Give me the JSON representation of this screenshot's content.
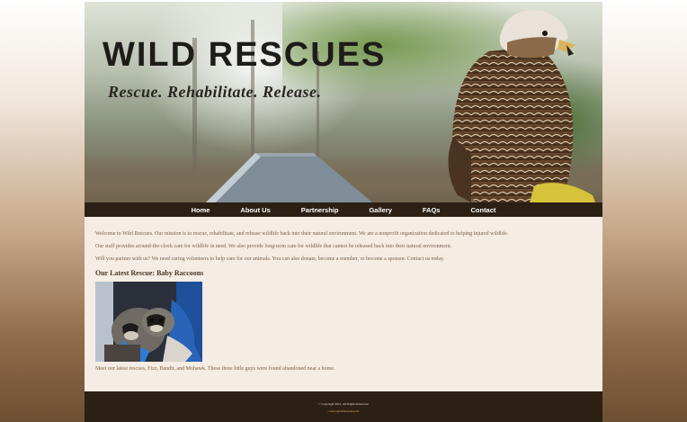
{
  "header": {
    "title": "WILD RESCUES",
    "tagline": "Rescue. Rehabilitate. Release."
  },
  "nav": {
    "items": [
      {
        "label": "Home"
      },
      {
        "label": "About Us"
      },
      {
        "label": "Partnership"
      },
      {
        "label": "Gallery"
      },
      {
        "label": "FAQs"
      },
      {
        "label": "Contact"
      }
    ]
  },
  "content": {
    "paragraphs": [
      "Welcome to Wild Rescues. Our mission is to rescue, rehabilitate, and release wildlife back into their natural environment. We are a nonprofit organization dedicated to helping injured wildlife.",
      "Our staff provides around-the-clock care for wildlife in need. We also provide long-term care for wildlife that cannot be released back into their natural environment.",
      "Will you partner with us? We need caring volunteers to help care for our animals. You can also donate, become a member, or become a sponsor. Contact us today."
    ],
    "latest_heading": "Our Latest Rescue: Baby Raccoons",
    "latest_caption": "Meet our latest rescues, Fizz, Bandit, and Mohawk. These three little guys were found abandoned near a home."
  },
  "footer": {
    "copyright": "© Copyright 2021. All Rights Reserved.",
    "email": "contact@wildrescues.net"
  },
  "colors": {
    "nav_bg": "#2c1f14",
    "page_bg": "#f5ece4",
    "text": "#7a5f45",
    "heading": "#4a3626"
  }
}
